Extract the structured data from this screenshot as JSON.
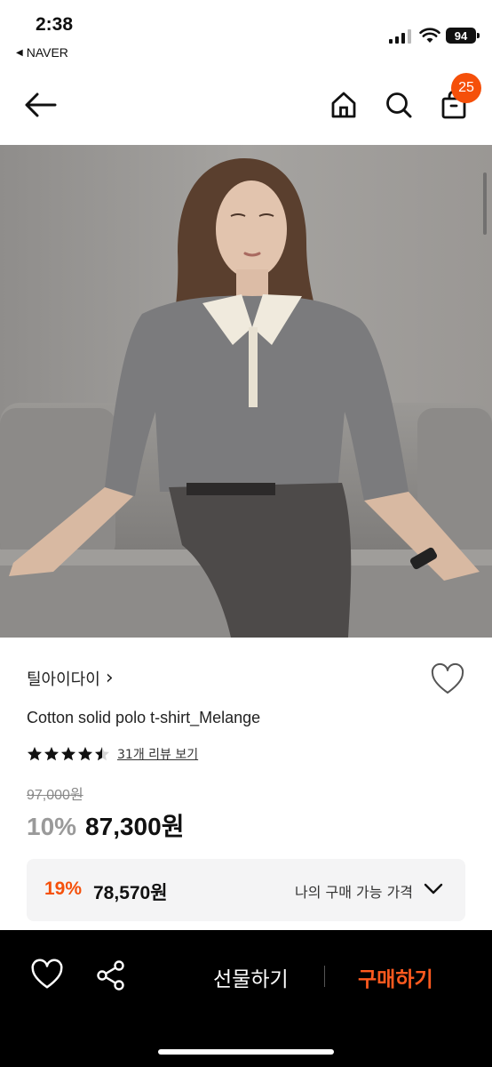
{
  "status_bar": {
    "time": "2:38",
    "back_app": "NAVER",
    "battery": "94"
  },
  "header": {
    "cart_count": "25"
  },
  "product": {
    "brand": "틸아이다이",
    "brand_chevron": "›",
    "name": "Cotton solid polo t-shirt_Melange",
    "rating": 4.5,
    "review_link": "31개 리뷰 보기",
    "original_price": "97,000원",
    "discount_rate": "10%",
    "price": "87,300원"
  },
  "coupon": {
    "discount_rate": "19%",
    "price": "78,570원",
    "label": "나의 구매 가능 가격"
  },
  "bottom_bar": {
    "gift_label": "선물하기",
    "buy_label": "구매하기"
  },
  "colors": {
    "accent": "#f5500a",
    "buy": "#ff5a1f"
  },
  "icons": [
    "back-arrow-icon",
    "home-icon",
    "search-icon",
    "bag-icon",
    "heart-icon",
    "share-icon",
    "chevron-down-icon",
    "star-icon"
  ]
}
